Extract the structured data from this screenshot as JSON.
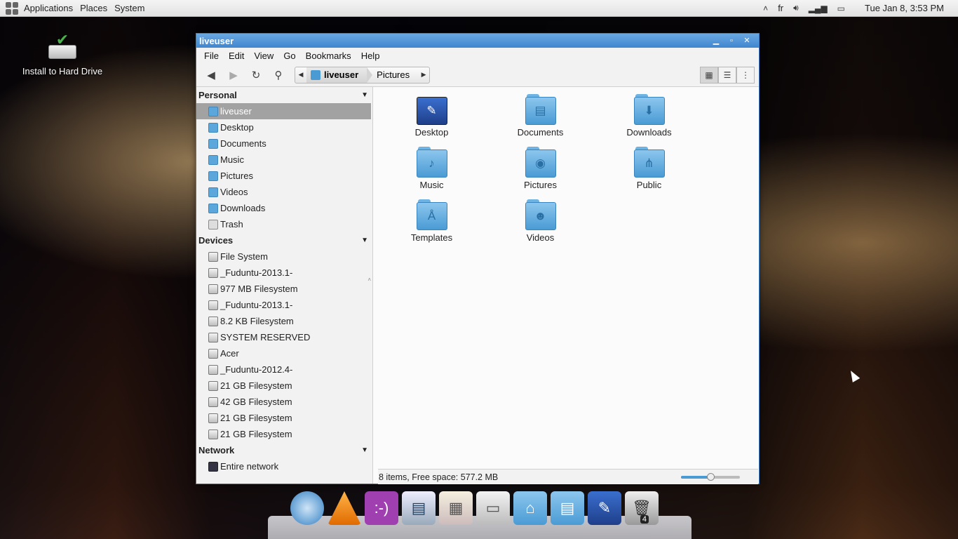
{
  "top_panel": {
    "menus": [
      "Applications",
      "Places",
      "System"
    ],
    "keyboard_layout": "fr",
    "clock": "Tue Jan  8,  3:53 PM"
  },
  "desktop": {
    "icon_label": "Install to Hard Drive"
  },
  "window": {
    "title": "liveuser",
    "menus": [
      "File",
      "Edit",
      "View",
      "Go",
      "Bookmarks",
      "Help"
    ],
    "path": [
      "liveuser",
      "Pictures"
    ]
  },
  "sidebar": {
    "personal_label": "Personal",
    "personal": [
      "liveuser",
      "Desktop",
      "Documents",
      "Music",
      "Pictures",
      "Videos",
      "Downloads",
      "Trash"
    ],
    "devices_label": "Devices",
    "devices": [
      "File System",
      "_Fuduntu-2013.1-",
      "977 MB Filesystem",
      "_Fuduntu-2013.1-",
      "8.2 KB Filesystem",
      "SYSTEM RESERVED",
      "Acer",
      "_Fuduntu-2012.4-",
      "21 GB Filesystem",
      "42 GB Filesystem",
      "21 GB Filesystem",
      "21 GB Filesystem"
    ],
    "network_label": "Network",
    "network": [
      "Entire network"
    ]
  },
  "files": [
    {
      "name": "Desktop",
      "icon": "desktop-folder-icon"
    },
    {
      "name": "Documents",
      "icon": "documents-folder-icon"
    },
    {
      "name": "Downloads",
      "icon": "downloads-folder-icon"
    },
    {
      "name": "Music",
      "icon": "music-folder-icon"
    },
    {
      "name": "Pictures",
      "icon": "pictures-folder-icon"
    },
    {
      "name": "Public",
      "icon": "public-folder-icon"
    },
    {
      "name": "Templates",
      "icon": "templates-folder-icon"
    },
    {
      "name": "Videos",
      "icon": "videos-folder-icon"
    }
  ],
  "status": {
    "text": "8 items, Free space: 577.2 MB",
    "zoom_level": 0.5
  },
  "dock": {
    "trash_badge": "4"
  },
  "colors": {
    "titlebar": "#3f86cf",
    "folder": "#4a9bd4",
    "selection": "#a2a2a2"
  }
}
